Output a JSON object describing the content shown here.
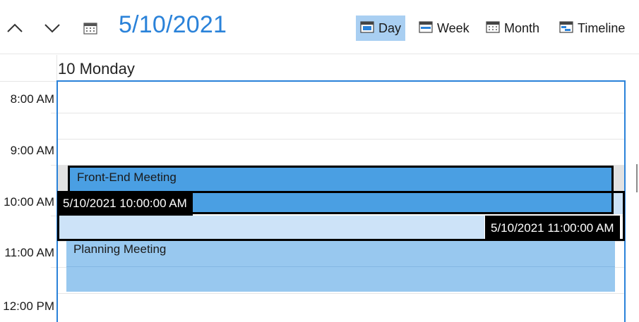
{
  "header": {
    "date_title": "5/10/2021",
    "views": [
      {
        "label": "Day",
        "icon": "day-view-icon",
        "active": true
      },
      {
        "label": "Week",
        "icon": "week-view-icon",
        "active": false
      },
      {
        "label": "Month",
        "icon": "month-view-icon",
        "active": false
      },
      {
        "label": "Timeline",
        "icon": "timeline-view-icon",
        "active": false
      }
    ],
    "accent_color": "#2a82d9",
    "active_view_bg": "#a9cff2"
  },
  "day_header": {
    "label": "10 Monday"
  },
  "time_slots": [
    "8:00 AM",
    "9:00 AM",
    "10:00 AM",
    "11:00 AM",
    "12:00 PM"
  ],
  "appointments": [
    {
      "subject": "Front-End Meeting",
      "color": "#4a9fe3"
    },
    {
      "subject": "Planning Meeting",
      "color": "#98c8ef"
    }
  ],
  "drag": {
    "start_tooltip": "5/10/2021 10:00:00 AM",
    "end_tooltip": "5/10/2021 11:00:00 AM"
  }
}
